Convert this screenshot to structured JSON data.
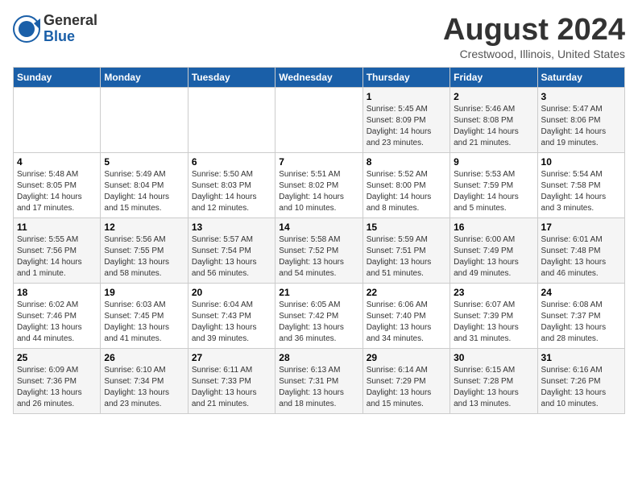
{
  "header": {
    "logo_line1": "General",
    "logo_line2": "Blue",
    "title": "August 2024",
    "subtitle": "Crestwood, Illinois, United States"
  },
  "days_of_week": [
    "Sunday",
    "Monday",
    "Tuesday",
    "Wednesday",
    "Thursday",
    "Friday",
    "Saturday"
  ],
  "weeks": [
    [
      {
        "day": "",
        "info": ""
      },
      {
        "day": "",
        "info": ""
      },
      {
        "day": "",
        "info": ""
      },
      {
        "day": "",
        "info": ""
      },
      {
        "day": "1",
        "info": "Sunrise: 5:45 AM\nSunset: 8:09 PM\nDaylight: 14 hours\nand 23 minutes."
      },
      {
        "day": "2",
        "info": "Sunrise: 5:46 AM\nSunset: 8:08 PM\nDaylight: 14 hours\nand 21 minutes."
      },
      {
        "day": "3",
        "info": "Sunrise: 5:47 AM\nSunset: 8:06 PM\nDaylight: 14 hours\nand 19 minutes."
      }
    ],
    [
      {
        "day": "4",
        "info": "Sunrise: 5:48 AM\nSunset: 8:05 PM\nDaylight: 14 hours\nand 17 minutes."
      },
      {
        "day": "5",
        "info": "Sunrise: 5:49 AM\nSunset: 8:04 PM\nDaylight: 14 hours\nand 15 minutes."
      },
      {
        "day": "6",
        "info": "Sunrise: 5:50 AM\nSunset: 8:03 PM\nDaylight: 14 hours\nand 12 minutes."
      },
      {
        "day": "7",
        "info": "Sunrise: 5:51 AM\nSunset: 8:02 PM\nDaylight: 14 hours\nand 10 minutes."
      },
      {
        "day": "8",
        "info": "Sunrise: 5:52 AM\nSunset: 8:00 PM\nDaylight: 14 hours\nand 8 minutes."
      },
      {
        "day": "9",
        "info": "Sunrise: 5:53 AM\nSunset: 7:59 PM\nDaylight: 14 hours\nand 5 minutes."
      },
      {
        "day": "10",
        "info": "Sunrise: 5:54 AM\nSunset: 7:58 PM\nDaylight: 14 hours\nand 3 minutes."
      }
    ],
    [
      {
        "day": "11",
        "info": "Sunrise: 5:55 AM\nSunset: 7:56 PM\nDaylight: 14 hours\nand 1 minute."
      },
      {
        "day": "12",
        "info": "Sunrise: 5:56 AM\nSunset: 7:55 PM\nDaylight: 13 hours\nand 58 minutes."
      },
      {
        "day": "13",
        "info": "Sunrise: 5:57 AM\nSunset: 7:54 PM\nDaylight: 13 hours\nand 56 minutes."
      },
      {
        "day": "14",
        "info": "Sunrise: 5:58 AM\nSunset: 7:52 PM\nDaylight: 13 hours\nand 54 minutes."
      },
      {
        "day": "15",
        "info": "Sunrise: 5:59 AM\nSunset: 7:51 PM\nDaylight: 13 hours\nand 51 minutes."
      },
      {
        "day": "16",
        "info": "Sunrise: 6:00 AM\nSunset: 7:49 PM\nDaylight: 13 hours\nand 49 minutes."
      },
      {
        "day": "17",
        "info": "Sunrise: 6:01 AM\nSunset: 7:48 PM\nDaylight: 13 hours\nand 46 minutes."
      }
    ],
    [
      {
        "day": "18",
        "info": "Sunrise: 6:02 AM\nSunset: 7:46 PM\nDaylight: 13 hours\nand 44 minutes."
      },
      {
        "day": "19",
        "info": "Sunrise: 6:03 AM\nSunset: 7:45 PM\nDaylight: 13 hours\nand 41 minutes."
      },
      {
        "day": "20",
        "info": "Sunrise: 6:04 AM\nSunset: 7:43 PM\nDaylight: 13 hours\nand 39 minutes."
      },
      {
        "day": "21",
        "info": "Sunrise: 6:05 AM\nSunset: 7:42 PM\nDaylight: 13 hours\nand 36 minutes."
      },
      {
        "day": "22",
        "info": "Sunrise: 6:06 AM\nSunset: 7:40 PM\nDaylight: 13 hours\nand 34 minutes."
      },
      {
        "day": "23",
        "info": "Sunrise: 6:07 AM\nSunset: 7:39 PM\nDaylight: 13 hours\nand 31 minutes."
      },
      {
        "day": "24",
        "info": "Sunrise: 6:08 AM\nSunset: 7:37 PM\nDaylight: 13 hours\nand 28 minutes."
      }
    ],
    [
      {
        "day": "25",
        "info": "Sunrise: 6:09 AM\nSunset: 7:36 PM\nDaylight: 13 hours\nand 26 minutes."
      },
      {
        "day": "26",
        "info": "Sunrise: 6:10 AM\nSunset: 7:34 PM\nDaylight: 13 hours\nand 23 minutes."
      },
      {
        "day": "27",
        "info": "Sunrise: 6:11 AM\nSunset: 7:33 PM\nDaylight: 13 hours\nand 21 minutes."
      },
      {
        "day": "28",
        "info": "Sunrise: 6:13 AM\nSunset: 7:31 PM\nDaylight: 13 hours\nand 18 minutes."
      },
      {
        "day": "29",
        "info": "Sunrise: 6:14 AM\nSunset: 7:29 PM\nDaylight: 13 hours\nand 15 minutes."
      },
      {
        "day": "30",
        "info": "Sunrise: 6:15 AM\nSunset: 7:28 PM\nDaylight: 13 hours\nand 13 minutes."
      },
      {
        "day": "31",
        "info": "Sunrise: 6:16 AM\nSunset: 7:26 PM\nDaylight: 13 hours\nand 10 minutes."
      }
    ]
  ]
}
